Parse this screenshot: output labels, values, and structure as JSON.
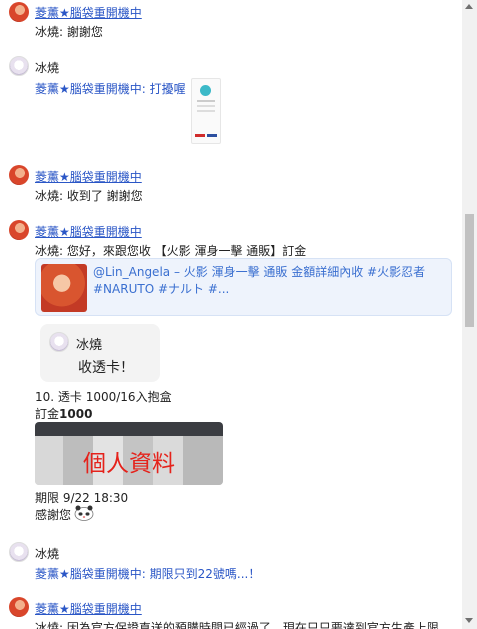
{
  "messages": [
    {
      "name": "菱薰★腦袋重開機中",
      "text": "冰燒: 謝謝您"
    },
    {
      "name": "冰燒",
      "text": "菱薰★腦袋重開機中: 打擾喔"
    },
    {
      "name": "菱薰★腦袋重開機中",
      "text": "冰燒: 收到了 謝謝您"
    },
    {
      "name": "菱薰★腦袋重開機中",
      "text": "冰燒: 您好，來跟您收 【火影 渾身一擊 通販】訂金"
    },
    {
      "name": "冰燒",
      "text": "菱薰★腦袋重開機中: 期限只到22號嗎...！"
    },
    {
      "name": "菱薰★腦袋重開機中",
      "text": "冰燒: 因為官方保證直送的預購時間已經過了，現在只只要達到官方生產上限"
    }
  ],
  "link_preview": {
    "line1": "@Lin_Angela – 火影 渾身一擊 通販 金額詳細內收 #火影忍者",
    "line2": "#NARUTO #ナルト #..."
  },
  "quote": {
    "name": "冰燒",
    "text": "收透卡！"
  },
  "order": {
    "line1": "10. 透卡 1000/16入抱盒",
    "deposit_label": "訂金",
    "deposit_value": "1000",
    "image_overlay": "個人資料",
    "deadline": "期限 9/22 18:30",
    "thanks": "感謝您"
  }
}
